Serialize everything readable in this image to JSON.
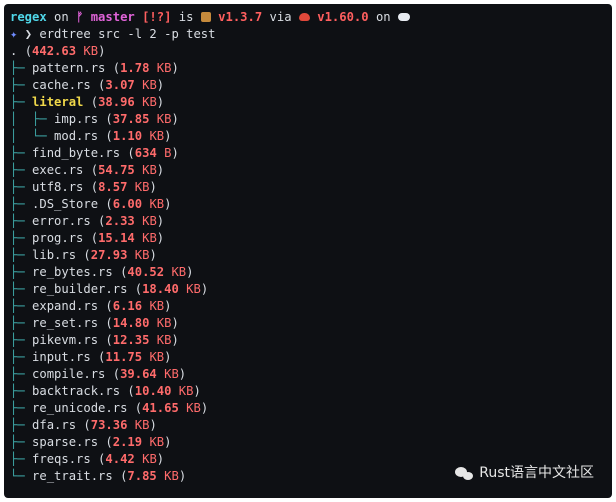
{
  "prompt": {
    "repo": "regex",
    "on1": "on",
    "branch_icon": "git-branch-icon",
    "branch": "master",
    "status": "[!?]",
    "is": "is",
    "package_icon": "package-box-icon",
    "version": "v1.3.7",
    "via": "via",
    "rust_icon": "rust-crab-icon",
    "rust_version": "v1.60.0",
    "on2": "on",
    "cloud_icon": "cloud-icon",
    "symbol": "✦",
    "arrow": "❯",
    "command": "erdtree src -l 2 -p test"
  },
  "root": {
    "name": ".",
    "size": "442.63",
    "unit": "KB"
  },
  "entries": [
    {
      "prefix": "├─ ",
      "name": "pattern.rs",
      "size": "1.78",
      "unit": "KB",
      "dir": false
    },
    {
      "prefix": "├─ ",
      "name": "cache.rs",
      "size": "3.07",
      "unit": "KB",
      "dir": false
    },
    {
      "prefix": "├─ ",
      "name": "literal",
      "size": "38.96",
      "unit": "KB",
      "dir": true
    },
    {
      "prefix": "│  ├─ ",
      "name": "imp.rs",
      "size": "37.85",
      "unit": "KB",
      "dir": false
    },
    {
      "prefix": "│  └─ ",
      "name": "mod.rs",
      "size": "1.10",
      "unit": "KB",
      "dir": false
    },
    {
      "prefix": "├─ ",
      "name": "find_byte.rs",
      "size": "634",
      "unit": "B",
      "dir": false
    },
    {
      "prefix": "├─ ",
      "name": "exec.rs",
      "size": "54.75",
      "unit": "KB",
      "dir": false
    },
    {
      "prefix": "├─ ",
      "name": "utf8.rs",
      "size": "8.57",
      "unit": "KB",
      "dir": false
    },
    {
      "prefix": "├─ ",
      "name": ".DS_Store",
      "size": "6.00",
      "unit": "KB",
      "dir": false
    },
    {
      "prefix": "├─ ",
      "name": "error.rs",
      "size": "2.33",
      "unit": "KB",
      "dir": false
    },
    {
      "prefix": "├─ ",
      "name": "prog.rs",
      "size": "15.14",
      "unit": "KB",
      "dir": false
    },
    {
      "prefix": "├─ ",
      "name": "lib.rs",
      "size": "27.93",
      "unit": "KB",
      "dir": false
    },
    {
      "prefix": "├─ ",
      "name": "re_bytes.rs",
      "size": "40.52",
      "unit": "KB",
      "dir": false
    },
    {
      "prefix": "├─ ",
      "name": "re_builder.rs",
      "size": "18.40",
      "unit": "KB",
      "dir": false
    },
    {
      "prefix": "├─ ",
      "name": "expand.rs",
      "size": "6.16",
      "unit": "KB",
      "dir": false
    },
    {
      "prefix": "├─ ",
      "name": "re_set.rs",
      "size": "14.80",
      "unit": "KB",
      "dir": false
    },
    {
      "prefix": "├─ ",
      "name": "pikevm.rs",
      "size": "12.35",
      "unit": "KB",
      "dir": false
    },
    {
      "prefix": "├─ ",
      "name": "input.rs",
      "size": "11.75",
      "unit": "KB",
      "dir": false
    },
    {
      "prefix": "├─ ",
      "name": "compile.rs",
      "size": "39.64",
      "unit": "KB",
      "dir": false
    },
    {
      "prefix": "├─ ",
      "name": "backtrack.rs",
      "size": "10.40",
      "unit": "KB",
      "dir": false
    },
    {
      "prefix": "├─ ",
      "name": "re_unicode.rs",
      "size": "41.65",
      "unit": "KB",
      "dir": false
    },
    {
      "prefix": "├─ ",
      "name": "dfa.rs",
      "size": "73.36",
      "unit": "KB",
      "dir": false
    },
    {
      "prefix": "├─ ",
      "name": "sparse.rs",
      "size": "2.19",
      "unit": "KB",
      "dir": false
    },
    {
      "prefix": "├─ ",
      "name": "freqs.rs",
      "size": "4.42",
      "unit": "KB",
      "dir": false
    },
    {
      "prefix": "└─ ",
      "name": "re_trait.rs",
      "size": "7.85",
      "unit": "KB",
      "dir": false
    }
  ],
  "watermark": {
    "icon": "wechat-icon",
    "text": "Rust语言中文社区"
  }
}
